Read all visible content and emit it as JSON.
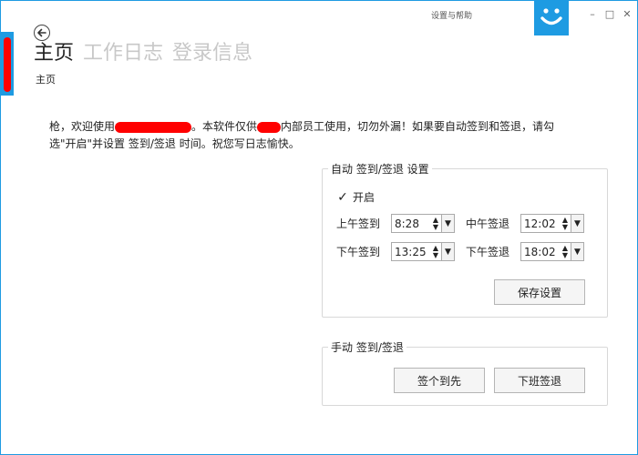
{
  "window": {
    "title": "设置与帮助",
    "minimize_symbol": "–",
    "maximize_symbol": "□",
    "close_symbol": "✕",
    "accent_color": "#1e9be2"
  },
  "nav": {
    "back_icon": "arrow-left-icon",
    "tabs": [
      {
        "label": "主页"
      },
      {
        "label": "工作日志"
      },
      {
        "label": "登录信息"
      }
    ],
    "breadcrumb": "主页"
  },
  "welcome": {
    "line1_part1": "枪，欢迎使用",
    "line1_part2": "。本软件仅供",
    "line1_part3": "内部员工使用，切勿外漏！如果要自动签到和签退，请勾",
    "line2": "选\"开启\"并设置 签到/签退 时间。祝您写日志愉快。"
  },
  "auto_settings": {
    "title": "自动 签到/签退 设置",
    "enable_label": "开启",
    "enabled": true,
    "am_checkin_label": "上午签到",
    "am_checkin_value": "8:28",
    "noon_checkout_label": "中午签退",
    "noon_checkout_value": "12:02",
    "pm_checkin_label": "下午签到",
    "pm_checkin_value": "13:25",
    "pm_checkout_label": "下午签退",
    "pm_checkout_value": "18:02",
    "save_button": "保存设置"
  },
  "manual": {
    "title": "手动 签到/签退",
    "checkin_button": "签个到先",
    "checkout_button": "下班签退"
  }
}
